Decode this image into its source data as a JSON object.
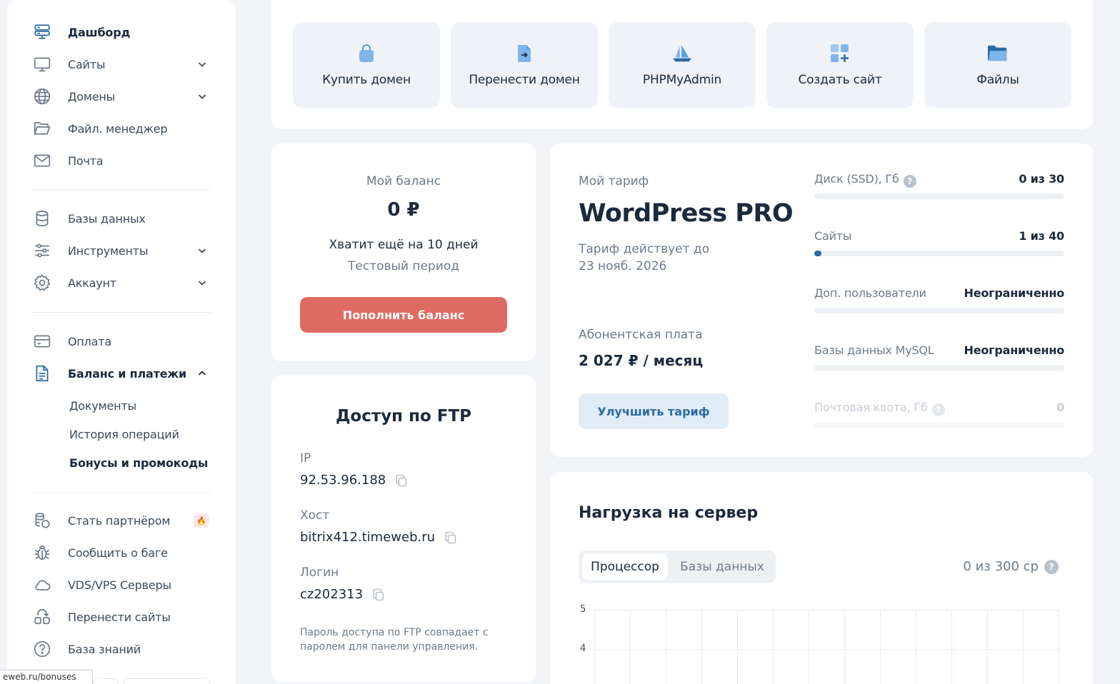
{
  "sidebar": {
    "items": [
      {
        "label": "Дашборд",
        "icon": "dashboard-icon"
      },
      {
        "label": "Сайты",
        "icon": "monitor-icon"
      },
      {
        "label": "Домены",
        "icon": "globe-icon"
      },
      {
        "label": "Файл. менеджер",
        "icon": "folder-icon"
      },
      {
        "label": "Почта",
        "icon": "mail-icon"
      },
      {
        "label": "Базы данных",
        "icon": "database-icon"
      },
      {
        "label": "Инструменты",
        "icon": "sliders-icon"
      },
      {
        "label": "Аккаунт",
        "icon": "gear-icon"
      },
      {
        "label": "Оплата",
        "icon": "card-icon"
      },
      {
        "label": "Баланс и платежи",
        "icon": "document-icon"
      },
      {
        "label": "Стать партнёром",
        "icon": "coins-icon"
      },
      {
        "label": "Сообщить о баге",
        "icon": "bug-icon"
      },
      {
        "label": "VDS/VPS Серверы",
        "icon": "cloud-icon"
      },
      {
        "label": "Перенести сайты",
        "icon": "transfer-icon"
      },
      {
        "label": "База знаний",
        "icon": "question-icon"
      }
    ],
    "sub_items": [
      "Документы",
      "История операций",
      "Бонусы и промокоды"
    ],
    "partner_badge": "🔥",
    "url_tip": "eweb.ru/bonuses"
  },
  "quick_actions": [
    {
      "label": "Купить домен",
      "icon": "shopping-bag-icon"
    },
    {
      "label": "Перенести домен",
      "icon": "file-transfer-icon"
    },
    {
      "label": "PHPMyAdmin",
      "icon": "phpmyadmin-icon"
    },
    {
      "label": "Создать сайт",
      "icon": "grid-plus-icon"
    },
    {
      "label": "Файлы",
      "icon": "folder-open-icon"
    }
  ],
  "balance": {
    "title": "Мой баланс",
    "amount": "0 ₽",
    "days_left": "Хватит ещё на 10 дней",
    "period": "Тестовый период",
    "topup_button": "Пополнить баланс"
  },
  "tariff": {
    "title": "Мой тариф",
    "name": "WordPress PRO",
    "valid_label": "Тариф действует до",
    "valid_date": "23 нояб. 2026",
    "fee_label": "Абонентская плата",
    "fee_value": "2 027 ₽ / месяц",
    "upgrade_button": "Улучшить тариф",
    "resources": [
      {
        "label": "Диск (SSD), Гб",
        "value": "0 из 30",
        "help": "?",
        "fill": 0
      },
      {
        "label": "Сайты",
        "value": "1 из 40",
        "fill": 0.025
      },
      {
        "label": "Доп. пользователи",
        "value": "Неограниченно",
        "fill": 0
      },
      {
        "label": "Базы данных MySQL",
        "value": "Неограниченно",
        "fill": 0
      },
      {
        "label": "Почтовая квота, Гб",
        "value": "0",
        "help": "?",
        "fill": 0
      }
    ],
    "accent": "#2c6aa4"
  },
  "ftp": {
    "title": "Доступ по FTP",
    "ip_label": "IP",
    "ip_value": "92.53.96.188",
    "host_label": "Хост",
    "host_value": "bitrix412.timeweb.ru",
    "login_label": "Логин",
    "login_value": "cz202313",
    "note": "Пароль доступа по FTP совпадает с паролем для панели управления."
  },
  "server_load": {
    "title": "Нагрузка на сервер",
    "tabs": [
      "Процессор",
      "Базы данных"
    ],
    "active_tab": "Процессор",
    "usage": "0 из 300 ср",
    "help": "?"
  },
  "chart_data": {
    "type": "line",
    "yticks": [
      "5",
      "4"
    ],
    "series": []
  },
  "colors": {
    "topup_button": "#de6b63",
    "upgrade_button_bg": "#e1ecf7",
    "accent": "#2c6aa4"
  }
}
